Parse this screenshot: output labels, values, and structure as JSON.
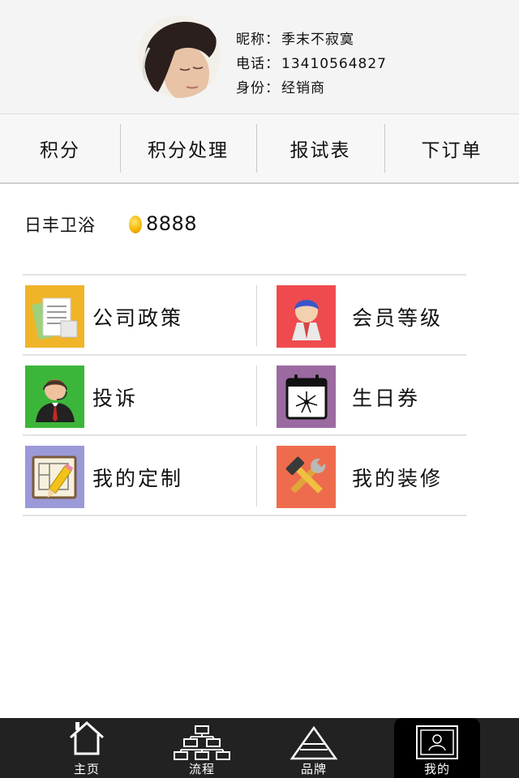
{
  "profile": {
    "nickname_label": "昵称：",
    "nickname": "季末不寂寞",
    "phone_label": "电话：",
    "phone": "13410564827",
    "role_label": "身份：",
    "role": "经销商"
  },
  "tabs": [
    {
      "label": "积分"
    },
    {
      "label": "积分处理"
    },
    {
      "label": "报试表"
    },
    {
      "label": "下订单"
    }
  ],
  "store": {
    "name": "日丰卫浴",
    "points": "8888"
  },
  "grid": [
    {
      "label": "公司政策",
      "icon": "folder-documents-icon",
      "color": "#f0b428"
    },
    {
      "label": "会员等级",
      "icon": "member-avatar-icon",
      "color": "#ef4b4f"
    },
    {
      "label": "投诉",
      "icon": "customer-service-icon",
      "color": "#3cb63a"
    },
    {
      "label": "生日券",
      "icon": "calendar-fireworks-icon",
      "color": "#9b6aa0"
    },
    {
      "label": "我的定制",
      "icon": "blueprint-pencil-icon",
      "color": "#9b9ad8"
    },
    {
      "label": "我的装修",
      "icon": "hammer-wrench-icon",
      "color": "#ee6c4d"
    }
  ],
  "bottom_nav": [
    {
      "label": "主页",
      "icon": "home-icon"
    },
    {
      "label": "流程",
      "icon": "flowchart-icon"
    },
    {
      "label": "品牌",
      "icon": "brand-triangle-icon"
    },
    {
      "label": "我的",
      "icon": "profile-card-icon",
      "active": true
    }
  ]
}
